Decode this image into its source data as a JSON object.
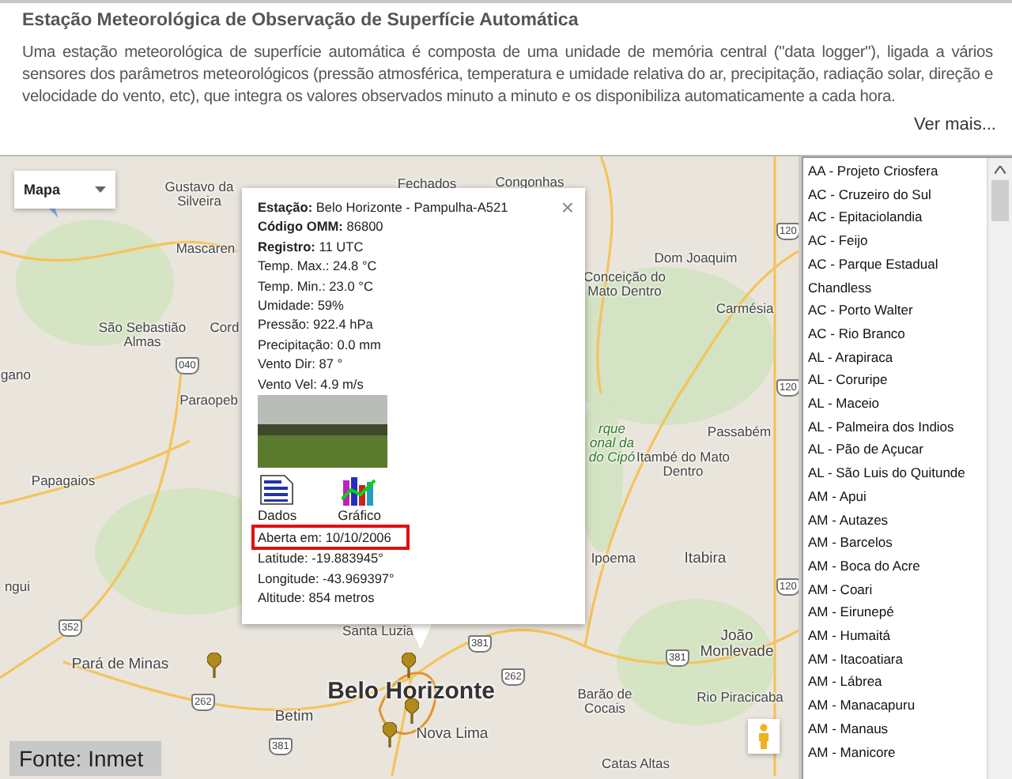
{
  "header": {
    "title": "Estação Meteorológica de Observação de Superfície Automática",
    "description": "Uma estação meteorológica de superfície automática é composta de uma unidade de memória central (\"data logger\"), ligada a vários sensores dos parâmetros meteorológicos (pressão atmosférica, temperatura e umidade relativa do ar, precipitação, radiação solar, direção e velocidade do vento, etc), que integra os valores observados minuto a minuto e os disponibiliza automaticamente a cada hora.",
    "more_link": "Ver mais..."
  },
  "map": {
    "type_control": "Mapa",
    "places": [
      {
        "label": "Gustavo da Silveira",
        "kind": "town"
      },
      {
        "label": "Fechados",
        "kind": "town"
      },
      {
        "label": "Congonhas",
        "kind": "town"
      },
      {
        "label": "Mascaren",
        "kind": "town"
      },
      {
        "label": "Dom Joaquim",
        "kind": "town"
      },
      {
        "label": "Conceição do Mato Dentro",
        "kind": "town"
      },
      {
        "label": "Carmésia",
        "kind": "town"
      },
      {
        "label": "São Sebastião Almas",
        "kind": "town"
      },
      {
        "label": "Cord",
        "kind": "town"
      },
      {
        "label": "gano",
        "kind": "town"
      },
      {
        "label": "Paraopeb",
        "kind": "town"
      },
      {
        "label": "rque onal da do Cipó",
        "kind": "park"
      },
      {
        "label": "Passabém",
        "kind": "town"
      },
      {
        "label": "Itambé do Mato Dentro",
        "kind": "town"
      },
      {
        "label": "Papagaios",
        "kind": "town"
      },
      {
        "label": "Ipoema",
        "kind": "town"
      },
      {
        "label": "Itabira",
        "kind": "city"
      },
      {
        "label": "ngui",
        "kind": "town"
      },
      {
        "label": "Santa Luzia",
        "kind": "town"
      },
      {
        "label": "João Monlevade",
        "kind": "city"
      },
      {
        "label": "Pará de Minas",
        "kind": "city"
      },
      {
        "label": "Belo Horizonte",
        "kind": "capital"
      },
      {
        "label": "Betim",
        "kind": "city"
      },
      {
        "label": "Nova Lima",
        "kind": "city"
      },
      {
        "label": "Barão de Cocais",
        "kind": "town"
      },
      {
        "label": "Rio Piracicaba",
        "kind": "town"
      },
      {
        "label": "Catas Altas",
        "kind": "town"
      }
    ],
    "road_shields": [
      "120",
      "040",
      "120",
      "120",
      "352",
      "381",
      "381",
      "262",
      "262",
      "381"
    ],
    "popup": {
      "close": "×",
      "fields": [
        {
          "text": "**Estação:** Belo Horizonte - Pampulha-A521",
          "highlighted": false
        },
        {
          "text": "**Código OMM:** 86800",
          "highlighted": false
        },
        {
          "text": "**Registro:** 11 UTC",
          "highlighted": false
        },
        {
          "text": "Temp. Max.: 24.8 °C",
          "highlighted": false
        },
        {
          "text": "Temp. Min.: 23.0 °C",
          "highlighted": false
        },
        {
          "text": "Umidade: 59%",
          "highlighted": false
        },
        {
          "text": "Pressão: 922.4 hPa",
          "highlighted": false
        },
        {
          "text": "Precipitação: 0.0 mm",
          "highlighted": false
        },
        {
          "text": "Vento Dir: 87 °",
          "highlighted": false
        },
        {
          "text": "Vento Vel: 4.9 m/s",
          "highlighted": false
        }
      ],
      "links": [
        {
          "label": "Dados",
          "kind": "data"
        },
        {
          "label": "Gráfico",
          "kind": "chart"
        }
      ],
      "details": [
        {
          "text": "Aberta em: 10/10/2006",
          "highlighted": true
        },
        {
          "text": "Latitude: -19.883945°",
          "highlighted": false
        },
        {
          "text": "Longitude: -43.969397°",
          "highlighted": false
        },
        {
          "text": "Altitude: 854 metros",
          "highlighted": false
        }
      ]
    },
    "source": "Fonte: Inmet"
  },
  "stations": [
    "AA - Projeto Criosfera",
    "AC - Cruzeiro do Sul",
    "AC - Epitaciolandia",
    "AC - Feijo",
    "AC - Parque Estadual",
    "Chandless",
    "AC - Porto Walter",
    "AC - Rio Branco",
    "AL - Arapiraca",
    "AL - Coruripe",
    "AL - Maceio",
    "AL - Palmeira dos Indios",
    "AL - Pão de Açucar",
    "AL - São Luis do Quitunde",
    "AM - Apui",
    "AM - Autazes",
    "AM - Barcelos",
    "AM - Boca do Acre",
    "AM - Coari",
    "AM - Eirunepé",
    "AM - Humaitá",
    "AM - Itacoatiara",
    "AM - Lábrea",
    "AM - Manacapuru",
    "AM - Manaus",
    "AM - Manicore"
  ]
}
